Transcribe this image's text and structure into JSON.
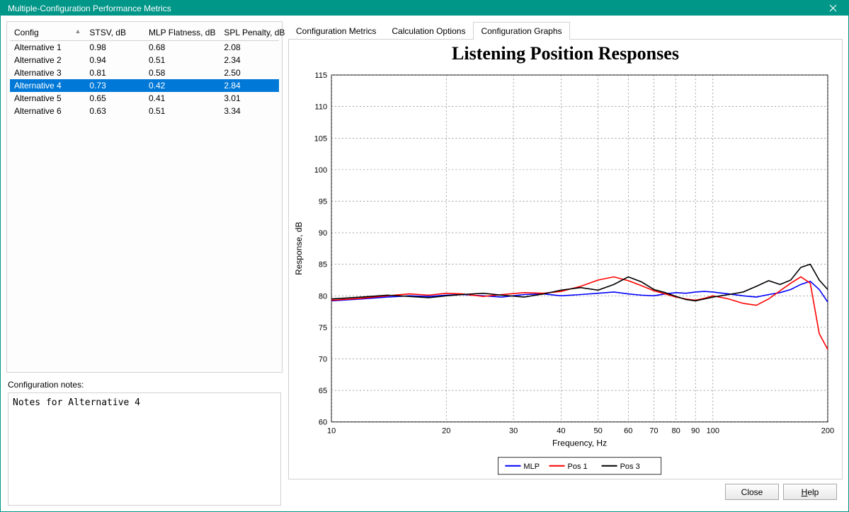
{
  "window": {
    "title": "Multiple-Configuration Performance Metrics"
  },
  "table": {
    "headers": {
      "config": "Config",
      "stsv": "STSV, dB",
      "flat": "MLP Flatness, dB",
      "spl": "SPL Penalty, dB"
    },
    "rows": [
      {
        "config": "Alternative 1",
        "stsv": "0.98",
        "flat": "0.68",
        "spl": "2.08"
      },
      {
        "config": "Alternative 2",
        "stsv": "0.94",
        "flat": "0.51",
        "spl": "2.34"
      },
      {
        "config": "Alternative 3",
        "stsv": "0.81",
        "flat": "0.58",
        "spl": "2.50"
      },
      {
        "config": "Alternative 4",
        "stsv": "0.73",
        "flat": "0.42",
        "spl": "2.84"
      },
      {
        "config": "Alternative 5",
        "stsv": "0.65",
        "flat": "0.41",
        "spl": "3.01"
      },
      {
        "config": "Alternative 6",
        "stsv": "0.63",
        "flat": "0.51",
        "spl": "3.34"
      }
    ],
    "selected_index": 3
  },
  "notes": {
    "label": "Configuration notes:",
    "text": "Notes for Alternative 4"
  },
  "tabs": {
    "t1": "Configuration Metrics",
    "t2": "Calculation Options",
    "t3": "Configuration Graphs",
    "active": "t3"
  },
  "buttons": {
    "close": "Close",
    "help": "Help"
  },
  "chart_data": {
    "type": "line",
    "title": "Listening Position Responses",
    "xlabel": "Frequency, Hz",
    "ylabel": "Response, dB",
    "ylim": [
      60,
      115
    ],
    "xlim": [
      10,
      200
    ],
    "yticks": [
      60,
      65,
      70,
      75,
      80,
      85,
      90,
      95,
      100,
      105,
      110,
      115
    ],
    "xticks": [
      10,
      20,
      30,
      40,
      50,
      60,
      70,
      80,
      90,
      100,
      200
    ],
    "legend": [
      "MLP",
      "Pos 1",
      "Pos 3"
    ],
    "x": [
      10,
      12,
      14,
      16,
      18,
      20,
      22,
      25,
      28,
      32,
      36,
      40,
      45,
      50,
      55,
      60,
      65,
      70,
      75,
      80,
      85,
      90,
      95,
      100,
      110,
      120,
      130,
      140,
      150,
      160,
      170,
      180,
      190,
      200
    ],
    "series": [
      {
        "name": "MLP",
        "color": "#0000ff",
        "values": [
          79.2,
          79.5,
          79.8,
          80.0,
          79.9,
          80.1,
          80.2,
          80.0,
          79.8,
          80.2,
          80.3,
          80.0,
          80.2,
          80.4,
          80.6,
          80.3,
          80.1,
          80.0,
          80.3,
          80.5,
          80.4,
          80.6,
          80.7,
          80.6,
          80.3,
          80.0,
          79.8,
          80.2,
          80.5,
          81.0,
          81.8,
          82.3,
          81.0,
          79.0
        ]
      },
      {
        "name": "Pos 1",
        "color": "#ff0000",
        "values": [
          79.3,
          79.6,
          80.0,
          80.3,
          80.1,
          80.4,
          80.3,
          79.9,
          80.2,
          80.5,
          80.4,
          80.7,
          81.5,
          82.5,
          83.0,
          82.4,
          81.6,
          80.8,
          80.3,
          79.8,
          79.5,
          79.3,
          79.6,
          80.0,
          79.5,
          78.8,
          78.5,
          79.5,
          80.8,
          82.0,
          83.0,
          82.0,
          74.0,
          71.5
        ]
      },
      {
        "name": "Pos 3",
        "color": "#000000",
        "values": [
          79.5,
          79.8,
          80.1,
          79.9,
          79.7,
          80.0,
          80.2,
          80.4,
          80.1,
          79.8,
          80.3,
          80.9,
          81.3,
          80.9,
          81.8,
          83.0,
          82.2,
          81.0,
          80.5,
          79.9,
          79.4,
          79.2,
          79.5,
          79.8,
          80.2,
          80.6,
          81.5,
          82.4,
          81.8,
          82.5,
          84.5,
          85.0,
          82.5,
          81.0
        ]
      }
    ]
  }
}
